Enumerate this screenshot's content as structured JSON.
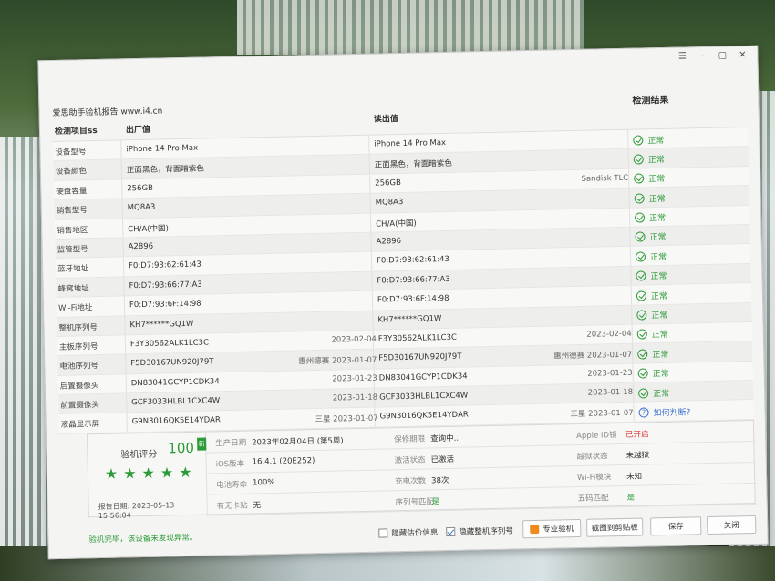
{
  "window": {
    "controls": [
      "☰",
      "–",
      "▢",
      "✕"
    ]
  },
  "report_title": "爱思助手验机报告 www.i4.cn",
  "headers": {
    "item": "检测项目ss",
    "factory": "出厂值",
    "read": "读出值",
    "result": "检测结果"
  },
  "rows": [
    {
      "label": "设备型号",
      "factory": "iPhone 14 Pro Max",
      "factory_extra": "",
      "read": "iPhone 14 Pro Max",
      "read_extra": "",
      "result": "正常"
    },
    {
      "label": "设备颜色",
      "factory": "正面黑色，背面暗紫色",
      "factory_extra": "",
      "read": "正面黑色，背面暗紫色",
      "read_extra": "",
      "result": "正常"
    },
    {
      "label": "硬盘容量",
      "factory": "256GB",
      "factory_extra": "",
      "read": "256GB",
      "read_extra": "Sandisk TLC",
      "result": "正常"
    },
    {
      "label": "销售型号",
      "factory": "MQ8A3",
      "factory_extra": "",
      "read": "MQ8A3",
      "read_extra": "",
      "result": "正常"
    },
    {
      "label": "销售地区",
      "factory": "CH/A(中国)",
      "factory_extra": "",
      "read": "CH/A(中国)",
      "read_extra": "",
      "result": "正常"
    },
    {
      "label": "监管型号",
      "factory": "A2896",
      "factory_extra": "",
      "read": "A2896",
      "read_extra": "",
      "result": "正常"
    },
    {
      "label": "蓝牙地址",
      "factory": "F0:D7:93:62:61:43",
      "factory_extra": "",
      "read": "F0:D7:93:62:61:43",
      "read_extra": "",
      "result": "正常"
    },
    {
      "label": "蜂窝地址",
      "factory": "F0:D7:93:66:77:A3",
      "factory_extra": "",
      "read": "F0:D7:93:66:77:A3",
      "read_extra": "",
      "result": "正常"
    },
    {
      "label": "Wi-Fi地址",
      "factory": "F0:D7:93:6F:14:98",
      "factory_extra": "",
      "read": "F0:D7:93:6F:14:98",
      "read_extra": "",
      "result": "正常"
    },
    {
      "label": "整机序列号",
      "factory": "KH7******GQ1W",
      "factory_extra": "",
      "read": "KH7******GQ1W",
      "read_extra": "",
      "result": "正常"
    },
    {
      "label": "主板序列号",
      "factory": "F3Y30562ALK1LC3C",
      "factory_extra": "2023-02-04",
      "read": "F3Y30562ALK1LC3C",
      "read_extra": "2023-02-04",
      "result": "正常"
    },
    {
      "label": "电池序列号",
      "factory": "F5D30167UN920J79T",
      "factory_extra": "惠州德赛 2023-01-07",
      "read": "F5D30167UN920J79T",
      "read_extra": "惠州德赛 2023-01-07",
      "result": "正常"
    },
    {
      "label": "后置摄像头",
      "factory": "DN83041GCYP1CDK34",
      "factory_extra": "2023-01-23",
      "read": "DN83041GCYP1CDK34",
      "read_extra": "2023-01-23",
      "result": "正常"
    },
    {
      "label": "前置摄像头",
      "factory": "GCF3033HLBL1CXC4W",
      "factory_extra": "2023-01-18",
      "read": "GCF3033HLBL1CXC4W",
      "read_extra": "2023-01-18",
      "result": "正常"
    },
    {
      "label": "液晶显示屏",
      "factory": "G9N3016QK5E14YDAR",
      "factory_extra": "三星 2023-01-07",
      "read": "G9N3016QK5E14YDAR",
      "read_extra": "三星 2023-01-07",
      "result": "如何判断?",
      "result_type": "link"
    }
  ],
  "summary": {
    "score_label": "验机评分",
    "score": "100",
    "badge": "新",
    "stars": 5,
    "report_date": "报告日期: 2023-05-13 15:56:04",
    "rows": [
      [
        {
          "k": "生产日期",
          "v": "2023年02月04日 (第5周)"
        },
        {
          "k": "保修期限",
          "v": "查询中..."
        },
        {
          "k": "Apple ID锁",
          "v": "已开启",
          "style": "red"
        }
      ],
      [
        {
          "k": "iOS版本",
          "v": "16.4.1 (20E252)"
        },
        {
          "k": "激活状态",
          "v": "已激活"
        },
        {
          "k": "越狱状态",
          "v": "未越狱"
        }
      ],
      [
        {
          "k": "电池寿命",
          "v": "100%"
        },
        {
          "k": "充电次数",
          "v": "38次"
        },
        {
          "k": "Wi-Fi模块",
          "v": "未知"
        }
      ],
      [
        {
          "k": "有无卡贴",
          "v": "无"
        },
        {
          "k": "序列号匹配",
          "v": "是",
          "style": "green"
        },
        {
          "k": "五码匹配",
          "v": "是",
          "style": "green"
        }
      ]
    ]
  },
  "footer": {
    "message": "验机完毕，该设备未发现异常。",
    "hide_price_label": "隐藏估价信息",
    "hide_serial_label": "隐藏整机序列号",
    "pro_button": "专业验机",
    "screenshot_button": "截图到剪贴板",
    "save_button": "保存",
    "close_button": "关闭"
  },
  "colors": {
    "ok_green": "#2e9b3a",
    "link_blue": "#3a6fd1",
    "alert_red": "#dd3333"
  }
}
